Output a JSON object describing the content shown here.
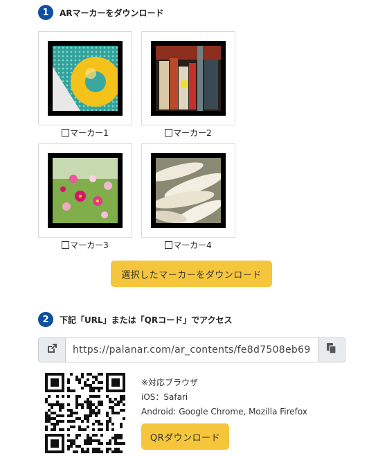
{
  "step1": {
    "number": "1",
    "title": "ARマーカーをダウンロード"
  },
  "markers": [
    {
      "label": "マーカー1",
      "checked": false
    },
    {
      "label": "マーカー2",
      "checked": false
    },
    {
      "label": "マーカー3",
      "checked": false
    },
    {
      "label": "マーカー4",
      "checked": false
    }
  ],
  "download_button": "選択したマーカーをダウンロード",
  "step2": {
    "number": "2",
    "title": "下記「URL」または「QRコード」でアクセス"
  },
  "url": {
    "value": "https://palanar.com/ar_contents/fe8d7508eb69"
  },
  "browsers": {
    "heading": "※対応ブラウザ",
    "ios": "iOS：Safari",
    "android": "Android: Google Chrome, Mozilla Firefox"
  },
  "qr_button": "QRダウンロード",
  "colors": {
    "accent": "#f5c53b",
    "step_badge": "#0d4fa0"
  }
}
